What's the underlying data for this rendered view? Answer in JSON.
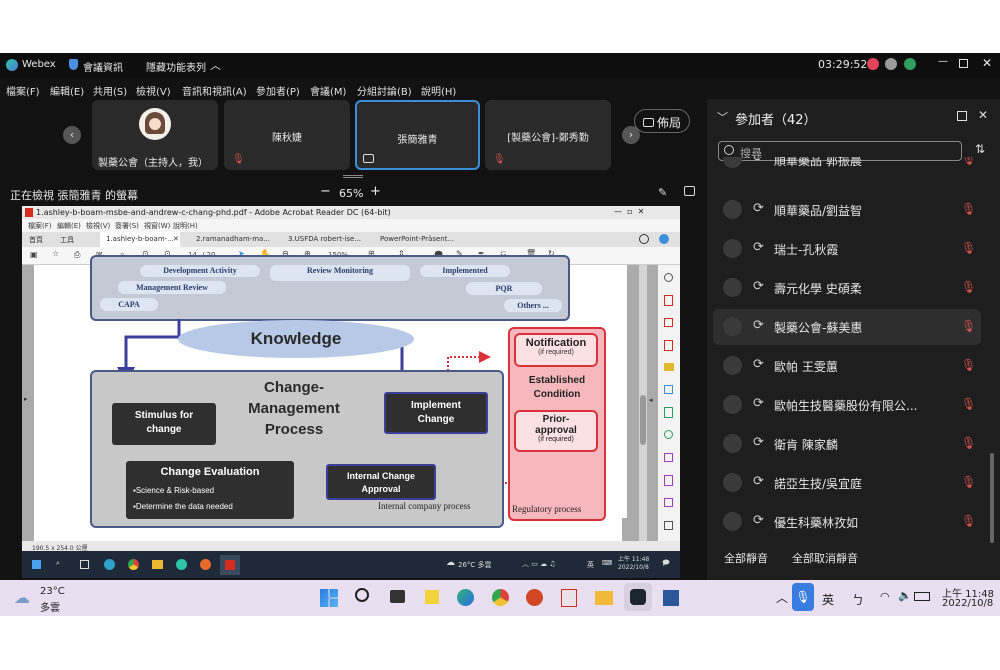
{
  "webex": {
    "app_name": "Webex",
    "meeting_info": "會議資訊",
    "hide_features": "隱藏功能表列",
    "time": "03:29:52"
  },
  "menu": [
    "檔案(F)",
    "編輯(E)",
    "共用(S)",
    "檢視(V)",
    "音訊和視訊(A)",
    "參加者(P)",
    "會議(M)",
    "分組討論(B)",
    "說明(H)"
  ],
  "tiles": [
    {
      "name": "製藥公會（主持人，我）"
    },
    {
      "name": "陳秋婕"
    },
    {
      "name": "張簡雅青"
    },
    {
      "name": "[製藥公會]-鄭秀勤"
    }
  ],
  "layout_label": "佈局",
  "viewing": "正在檢視 張簡雅青 的螢幕",
  "zoom": "65%",
  "acrobat": {
    "title": "1.ashley-b-boam-msbe-and-andrew-c-chang-phd.pdf - Adobe Acrobat Reader DC (64-bit)",
    "menu": [
      "檔案(F)",
      "編輯(E)",
      "檢視(V)",
      "簽署(S)",
      "視窗(W)",
      "說明(H)"
    ],
    "home": "首頁",
    "tools": "工具",
    "tabs": [
      "1.ashley-b-boam-...",
      "2.ramanadham-ma...",
      "3.USFDA robert-ise...",
      "PowerPoint-Präsent..."
    ],
    "page": "14",
    "pages": "/ 20",
    "zoom": "150%",
    "dims": "190.5 x 254.0 公厘"
  },
  "slide": {
    "top_items": [
      "Development Activity",
      "Review Monitoring",
      "Implemented",
      "Management Review",
      "PQR",
      "CAPA",
      "Others ..."
    ],
    "knowledge": "Knowledge",
    "process_title": [
      "Change-",
      "Management",
      "Process"
    ],
    "stimulus": [
      "Stimulus for",
      "change"
    ],
    "implement": [
      "Implement",
      "Change"
    ],
    "evaluation_title": "Change Evaluation",
    "evaluation_items": [
      "▪Science & Risk-based",
      "▪Determine the data needed"
    ],
    "internal_change": [
      "Internal Change",
      "Approval"
    ],
    "internal_label": "Internal company process",
    "notification": "Notification",
    "if_required": "(if required)",
    "established": [
      "Established",
      "Condition"
    ],
    "prior": [
      "Prior-",
      "approval"
    ],
    "regulatory": "Regulatory process"
  },
  "inner_taskbar": {
    "weather": "26°C 多雲",
    "lang": "英",
    "time": "上午 11:48",
    "date": "2022/10/8"
  },
  "participants": {
    "header": "參加者（42）",
    "search_placeholder": "搜尋",
    "list": [
      "順華藥品 郭振晨",
      "順華藥品/劉益智",
      "瑞士-孔秋霞",
      "壽元化學 史碩柔",
      "製藥公會-蘇美惠",
      "歐帕 王雯蕙",
      "歐帕生技醫藥股份有限公...",
      "衛肯 陳家麟",
      "諾亞生技/吳宜庭",
      "優生科藥林孜如"
    ],
    "mute_all": "全部靜音",
    "unmute_all": "全部取消靜音"
  },
  "taskbar": {
    "temp": "23°C",
    "cond": "多雲",
    "lang": "英",
    "ime": "ㄅ",
    "time": "上午 11:48",
    "date": "2022/10/8"
  },
  "colors": {
    "accent": "#3a8fd8",
    "mute": "#d9534f",
    "slide_dark": "#2f2f2f",
    "slide_blue": "#3b3f99",
    "reg_fill": "#f6b8bd",
    "reg_border": "#d9323a"
  }
}
